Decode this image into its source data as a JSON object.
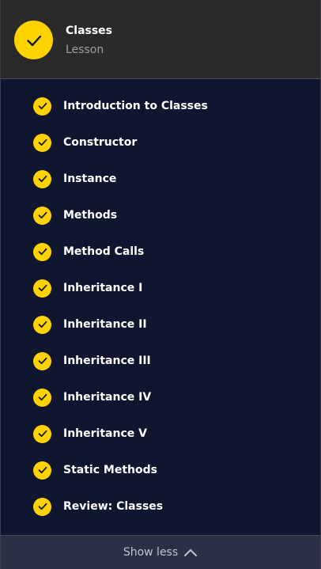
{
  "header": {
    "title": "Classes",
    "subtitle": "Lesson",
    "icon": "check-icon"
  },
  "items": [
    {
      "label": "Introduction to Classes",
      "completed": true
    },
    {
      "label": "Constructor",
      "completed": true
    },
    {
      "label": "Instance",
      "completed": true
    },
    {
      "label": "Methods",
      "completed": true
    },
    {
      "label": "Method Calls",
      "completed": true
    },
    {
      "label": "Inheritance I",
      "completed": true
    },
    {
      "label": "Inheritance II",
      "completed": true
    },
    {
      "label": "Inheritance III",
      "completed": true
    },
    {
      "label": "Inheritance IV",
      "completed": true
    },
    {
      "label": "Inheritance V",
      "completed": true
    },
    {
      "label": "Static Methods",
      "completed": true
    },
    {
      "label": "Review: Classes",
      "completed": true
    }
  ],
  "footer": {
    "label": "Show less",
    "icon": "chevron-up-icon"
  },
  "colors": {
    "accent": "#ffd300",
    "background": "#10162f",
    "header_background": "#2a2a2a",
    "footer_background": "#2c3044"
  }
}
